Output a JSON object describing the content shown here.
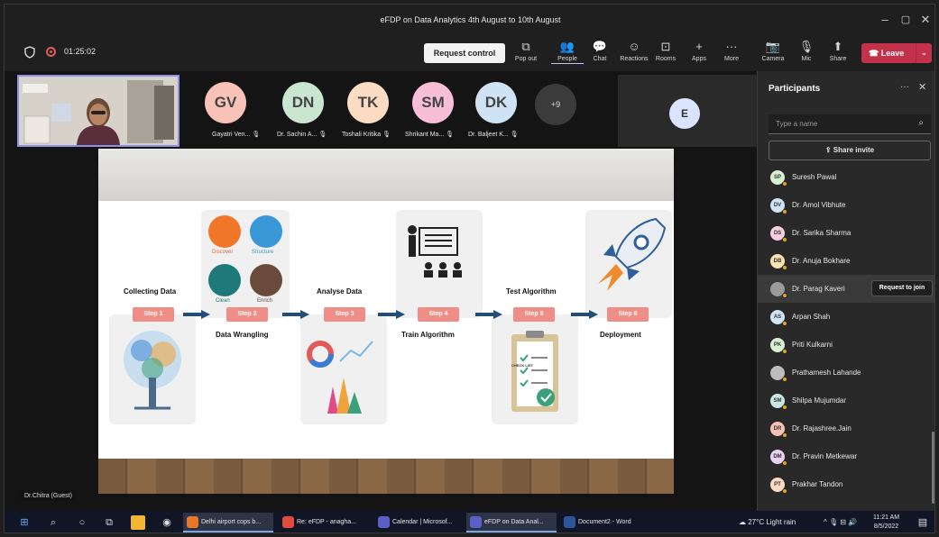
{
  "window": {
    "title": "eFDP on Data Analytics 4th August to 10th August"
  },
  "toolbar": {
    "timer": "01:25:02",
    "request_control": "Request control",
    "buttons": [
      "Pop out",
      "People",
      "Chat",
      "Reactions",
      "Rooms",
      "Apps",
      "More",
      "Camera",
      "Mic",
      "Share"
    ],
    "leave": "Leave"
  },
  "gallery": {
    "participants": [
      {
        "initials": "GV",
        "name": "Gayatri Ven...",
        "color": "#f9c2b6"
      },
      {
        "initials": "DN",
        "name": "Dr. Sachin A...",
        "color": "#c9e7d0"
      },
      {
        "initials": "TK",
        "name": "Toshali Kritika",
        "color": "#fbdcc3"
      },
      {
        "initials": "SM",
        "name": "Shrikant Ma...",
        "color": "#f7bfd6"
      },
      {
        "initials": "DK",
        "name": "Dr. Baljeet K...",
        "color": "#cfe3f5"
      }
    ],
    "more_count": "+9",
    "side_initial": "E",
    "self_label": "Dr.Chitra (Guest)"
  },
  "slide": {
    "steps": [
      {
        "label": "Step 1",
        "title": "Collecting Data"
      },
      {
        "label": "Step 2",
        "title": "Data Wrangling"
      },
      {
        "label": "Step 3",
        "title": "Analyse Data"
      },
      {
        "label": "Step 4",
        "title": "Train Algorithm"
      },
      {
        "label": "Step 5",
        "title": "Test Algorithm"
      },
      {
        "label": "Step 6",
        "title": "Deployment"
      }
    ],
    "wrangling": {
      "discover": "Discover",
      "structure": "Structure",
      "clean": "Clean",
      "enrich": "Enrich"
    },
    "checklist_title": "CHECK LIST"
  },
  "participants_panel": {
    "title": "Participants",
    "search_placeholder": "Type a name",
    "share_invite": "Share invite",
    "request_to_join": "Request to join",
    "list": [
      {
        "initials": "SP",
        "name": "Suresh Pawal",
        "color": "#d9efd2"
      },
      {
        "initials": "DV",
        "name": "Dr. Amol Vibhute",
        "color": "#cfe3f5"
      },
      {
        "initials": "DS",
        "name": "Dr. Sarika Sharma",
        "color": "#f7cfe0"
      },
      {
        "initials": "DB",
        "name": "Dr. Anuja Bokhare",
        "color": "#fbe2b0"
      },
      {
        "initials": "",
        "name": "Dr. Parag Kaveri",
        "color": "#9a9a9a"
      },
      {
        "initials": "AS",
        "name": "Arpan Shah",
        "color": "#cfe3f5"
      },
      {
        "initials": "PK",
        "name": "Priti Kulkarni",
        "color": "#d9efd2"
      },
      {
        "initials": "",
        "name": "Prathamesh Lahande",
        "color": "#bdbdbd"
      },
      {
        "initials": "SM",
        "name": "Shilpa Mujumdar",
        "color": "#c9e7e4"
      },
      {
        "initials": "DR",
        "name": "Dr. Rajashree.Jain",
        "color": "#f9c2b6"
      },
      {
        "initials": "DM",
        "name": "Dr. Pravin Metkewar",
        "color": "#e9d3f2"
      },
      {
        "initials": "PT",
        "name": "Prakhar Tandon",
        "color": "#fbdcc3"
      }
    ]
  },
  "taskbar": {
    "apps": [
      "Delhi airport cops b...",
      "Re: eFDP - anagha...",
      "Calendar | Microsof...",
      "eFDP on Data Anal...",
      "Document2 - Word"
    ],
    "weather": "27°C  Light rain",
    "time": "11:21 AM",
    "date": "8/5/2022"
  }
}
